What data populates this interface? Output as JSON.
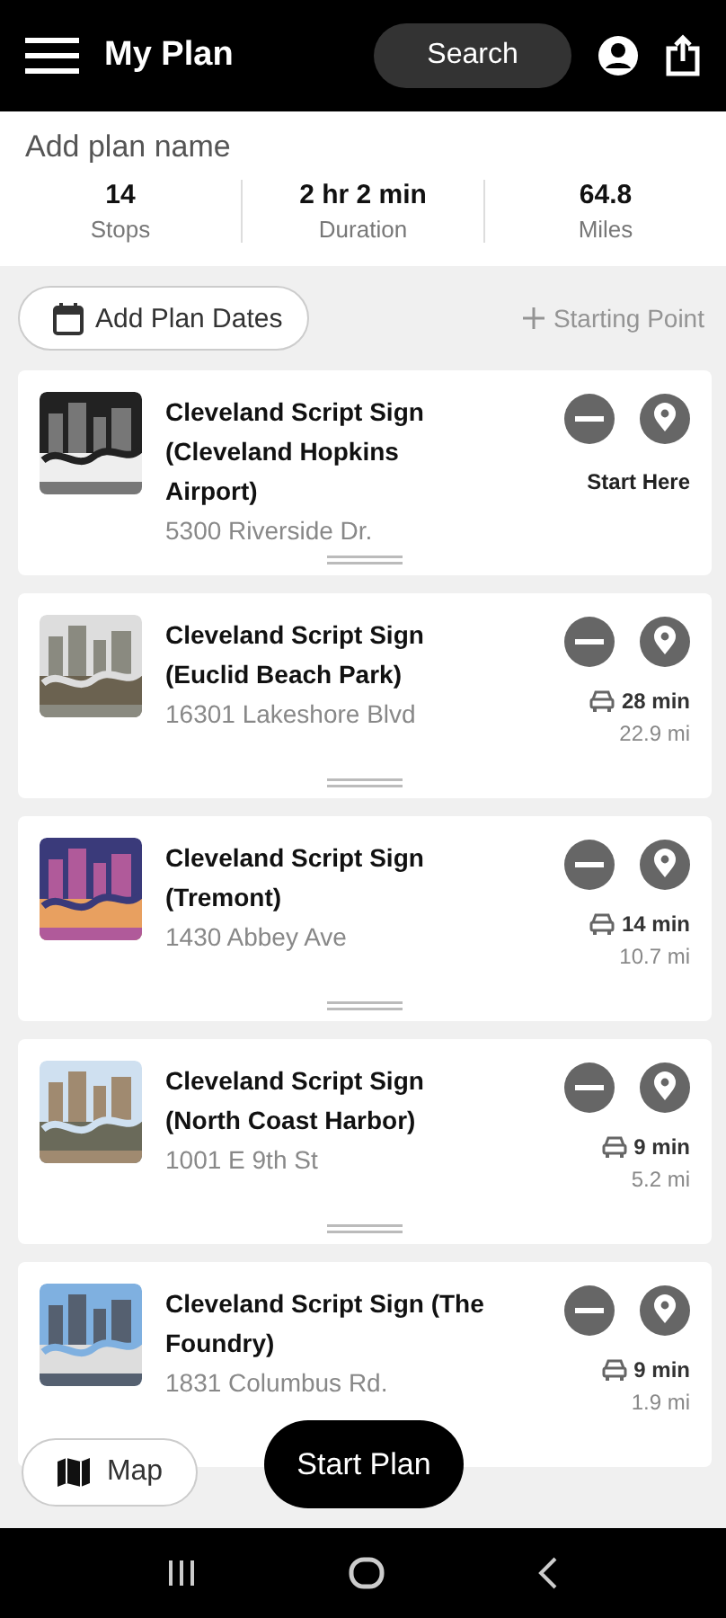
{
  "header": {
    "title": "My Plan",
    "search_label": "Search"
  },
  "plan": {
    "name_placeholder": "Add plan name",
    "stats": [
      {
        "value": "14",
        "label": "Stops"
      },
      {
        "value": "2 hr 2 min",
        "label": "Duration"
      },
      {
        "value": "64.8",
        "label": "Miles"
      }
    ]
  },
  "actions": {
    "dates_label": "Add Plan Dates",
    "starting_point": {
      "label": "Starting Point",
      "disabled": true
    }
  },
  "stops": [
    {
      "title": "Cleveland Script Sign (Cleveland Hopkins Airport)",
      "address": "5300 Riverside Dr.",
      "kind": "start",
      "label": "Start Here"
    },
    {
      "title": "Cleveland Script Sign (Euclid Beach Park)",
      "address": "16301 Lakeshore Blvd",
      "kind": "drive",
      "time": "28 min",
      "distance": "22.9 mi"
    },
    {
      "title": "Cleveland Script Sign (Tremont)",
      "address": "1430 Abbey Ave",
      "kind": "drive",
      "time": "14 min",
      "distance": "10.7 mi"
    },
    {
      "title": "Cleveland Script Sign (North Coast Harbor)",
      "address": "1001 E 9th St",
      "kind": "drive",
      "time": "9 min",
      "distance": "5.2 mi"
    },
    {
      "title": "Cleveland Script Sign (The Foundry)",
      "address": "1831 Columbus Rd.",
      "kind": "drive",
      "time": "9 min",
      "distance": "1.9 mi"
    }
  ],
  "map_label": "Map",
  "start_label": "Start Plan"
}
